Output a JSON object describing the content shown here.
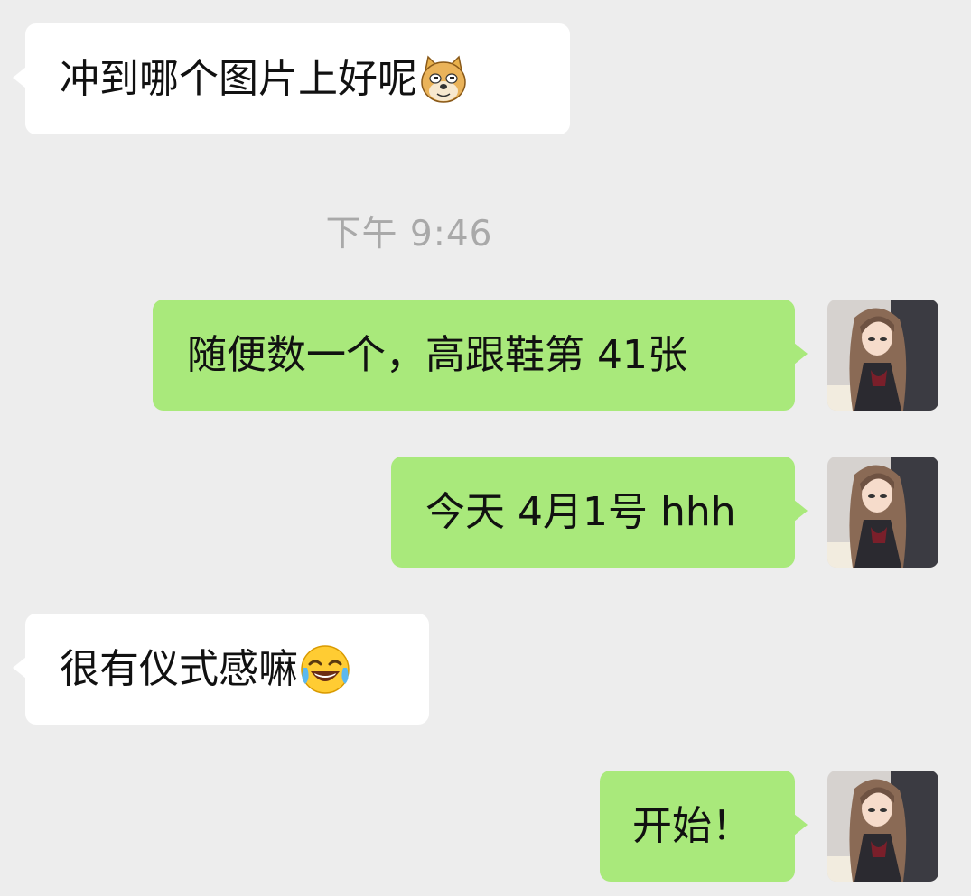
{
  "messages": [
    {
      "direction": "in",
      "text": "冲到哪个图片上好呢",
      "emoji": "doge-emoji"
    },
    {
      "direction": "out",
      "text": "随便数一个，高跟鞋第 41张"
    },
    {
      "direction": "out",
      "text": "今天 4月1号 hhh"
    },
    {
      "direction": "in",
      "text": "很有仪式感嘛",
      "emoji": "tears-of-joy-emoji"
    },
    {
      "direction": "out",
      "text": "开始！"
    }
  ],
  "timestamp": "下午 9:46",
  "avatar": {
    "icon": "anime-girl-avatar"
  },
  "colors": {
    "background": "#ededed",
    "incoming_bubble": "#ffffff",
    "outgoing_bubble": "#a9e97b",
    "timestamp_text": "#a9a9a9"
  }
}
